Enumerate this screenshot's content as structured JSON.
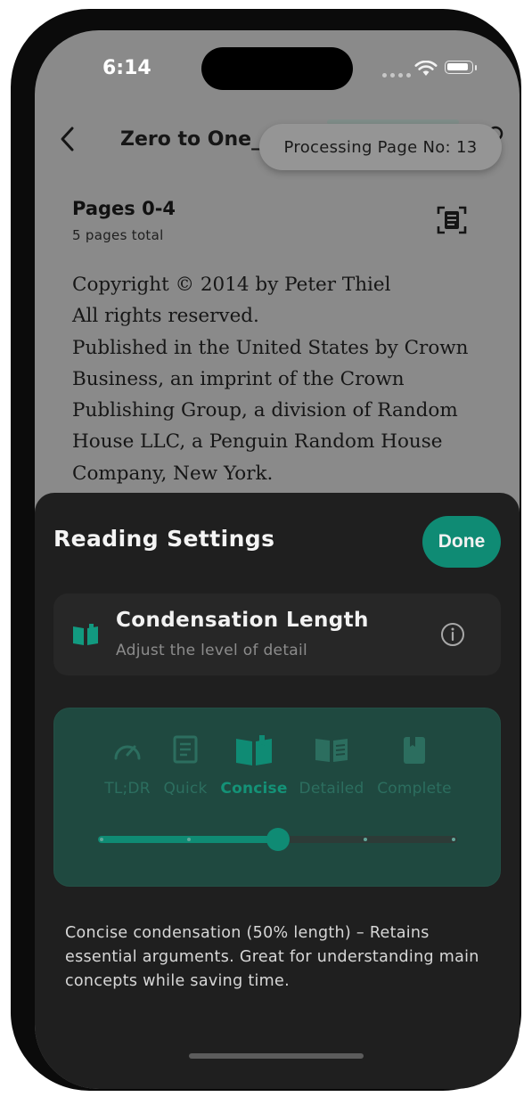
{
  "status_bar": {
    "time": "6:14"
  },
  "nav": {
    "title": "Zero to One_ M",
    "back_icon": "chevron-left-icon",
    "right_icon": "settings-icon"
  },
  "toast": {
    "text": "Processing Page No: 13"
  },
  "page_info": {
    "title": "Pages 0-4",
    "subtitle": "5 pages total",
    "action_icon": "document-scan-icon"
  },
  "book_text": [
    "Copyright © 2014 by Peter Thiel",
    "All rights reserved.",
    "Published in the United States by Crown",
    "Business, an imprint of the Crown",
    "Publishing Group, a division of Random",
    "House LLC, a Penguin Random House",
    "Company, New York."
  ],
  "sheet": {
    "title": "Reading Settings",
    "done_label": "Done",
    "condensation": {
      "title": "Condensation Length",
      "subtitle": "Adjust the level of detail",
      "icon": "open-book-icon",
      "info_icon": "info-icon"
    },
    "levels": [
      {
        "label": "TL;DR",
        "icon": "speedometer-icon"
      },
      {
        "label": "Quick",
        "icon": "document-icon"
      },
      {
        "label": "Concise",
        "icon": "open-book-icon"
      },
      {
        "label": "Detailed",
        "icon": "book-lines-icon"
      },
      {
        "label": "Complete",
        "icon": "bookmark-book-icon"
      }
    ],
    "selected_level": "Concise",
    "slider_position": 0.5,
    "description": "Concise condensation (50% length) – Retains essential arguments. Great for understanding main concepts while saving time."
  },
  "colors": {
    "accent": "#0f8b74",
    "sheet_bg": "#1f1f1f",
    "level_card_bg": "#1f4940"
  }
}
